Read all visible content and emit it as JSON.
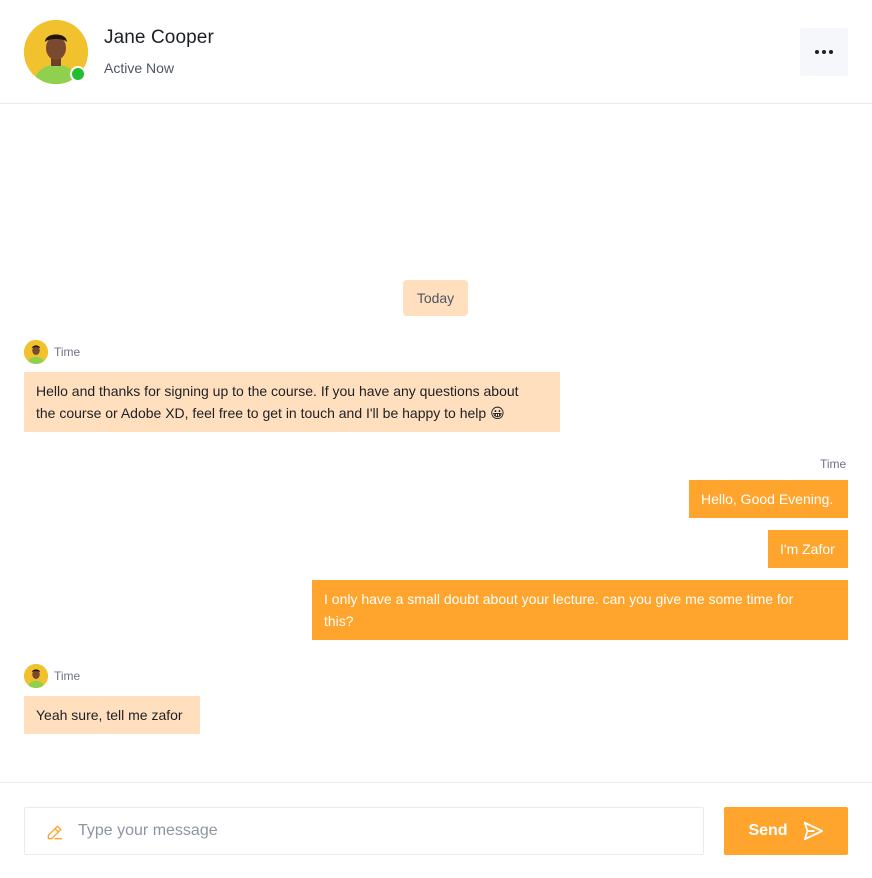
{
  "header": {
    "name": "Jane Cooper",
    "status": "Active Now",
    "menu_icon": "more-horizontal-icon",
    "status_color": "#23bd33"
  },
  "chat": {
    "day_label": "Today",
    "messages": [
      {
        "from": "contact",
        "time": "Time",
        "lines": [
          "Hello and thanks for signing up to the course. If you have any questions about",
          "the course or Adobe XD, feel free to get in touch and I'll be happy to help 😀"
        ]
      },
      {
        "from": "me",
        "time": "Time",
        "text": "Hello, Good Evening."
      },
      {
        "from": "me",
        "text": "I'm Zafor"
      },
      {
        "from": "me",
        "lines": [
          "I only have a small doubt about your lecture. can you give me some time for",
          "this?"
        ]
      },
      {
        "from": "contact",
        "time": "Time",
        "text": "Yeah sure, tell me zafor"
      }
    ]
  },
  "composer": {
    "placeholder": "Type your message",
    "value": "",
    "send_label": "Send",
    "edit_icon": "pencil-icon",
    "send_icon": "paper-plane-icon"
  },
  "colors": {
    "accent": "#ffa42c",
    "incoming_bubble": "#ffdfbd",
    "outgoing_bubble": "#ffa42c"
  }
}
